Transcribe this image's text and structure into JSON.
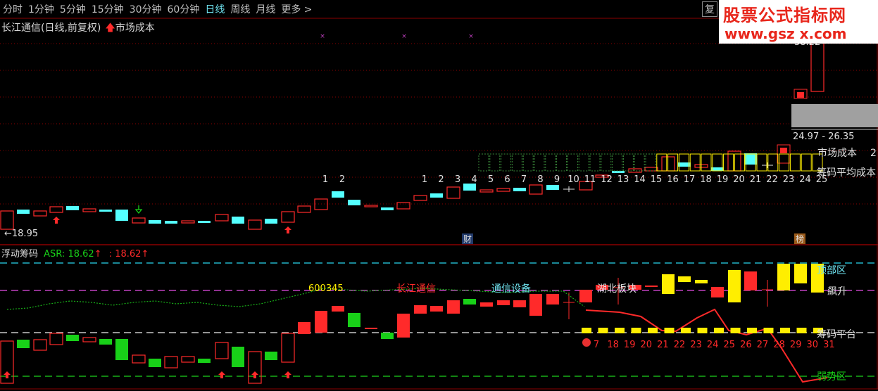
{
  "toolbar": {
    "items": [
      "分时",
      "1分钟",
      "5分钟",
      "15分钟",
      "30分钟",
      "60分钟",
      "日线",
      "周线",
      "月线",
      "更多 >"
    ],
    "active": "日线",
    "restore": "复"
  },
  "watermark": {
    "title": "股票公式指标网",
    "url": "www.gsz x.com"
  },
  "main": {
    "title": "长江通信(日线,前复权)",
    "indicator": "市场成本",
    "low_label": "←18.95",
    "high_label": "38.22",
    "range_label": "24.97 - 26.35",
    "cost_label": "市场成本",
    "cost_value": "2",
    "avg_label": "筹码平均成本",
    "markers": {
      "cai": "财",
      "bang": "榜"
    },
    "counts_a": [
      "1",
      "2"
    ],
    "counts_b": [
      "1",
      "2",
      "3",
      "4",
      "5",
      "6",
      "7",
      "8",
      "9",
      "10",
      "11",
      "12",
      "13",
      "14",
      "15",
      "16",
      "17",
      "18",
      "19",
      "20",
      "21",
      "22",
      "23",
      "24",
      "25"
    ]
  },
  "sub": {
    "title": "浮动筹码",
    "asr_label": "ASR: 18.62",
    "asr_value": ": 18.62",
    "code_label": "600345",
    "name_label": "长江通信",
    "sector1": "通信设备",
    "sector2": "湖北板块",
    "zone_top": "顶部区",
    "zone_rise": "飙升",
    "zone_platform": "筹码平台",
    "zone_weak": "弱势区",
    "days": [
      "7",
      "18",
      "19",
      "20",
      "21",
      "22",
      "23",
      "24",
      "25",
      "26",
      "27",
      "28",
      "29",
      "30",
      "31"
    ]
  },
  "colors": {
    "bg": "#000000",
    "up": "#ff2a2a",
    "down_main": "#54ffff",
    "down_sub": "#18d018",
    "yellow": "#ffee00",
    "grid": "#8b0000",
    "cyan": "#22b4c8",
    "magenta": "#c040c0",
    "green_dash": "#18b018",
    "white": "#e0e0e0"
  }
}
